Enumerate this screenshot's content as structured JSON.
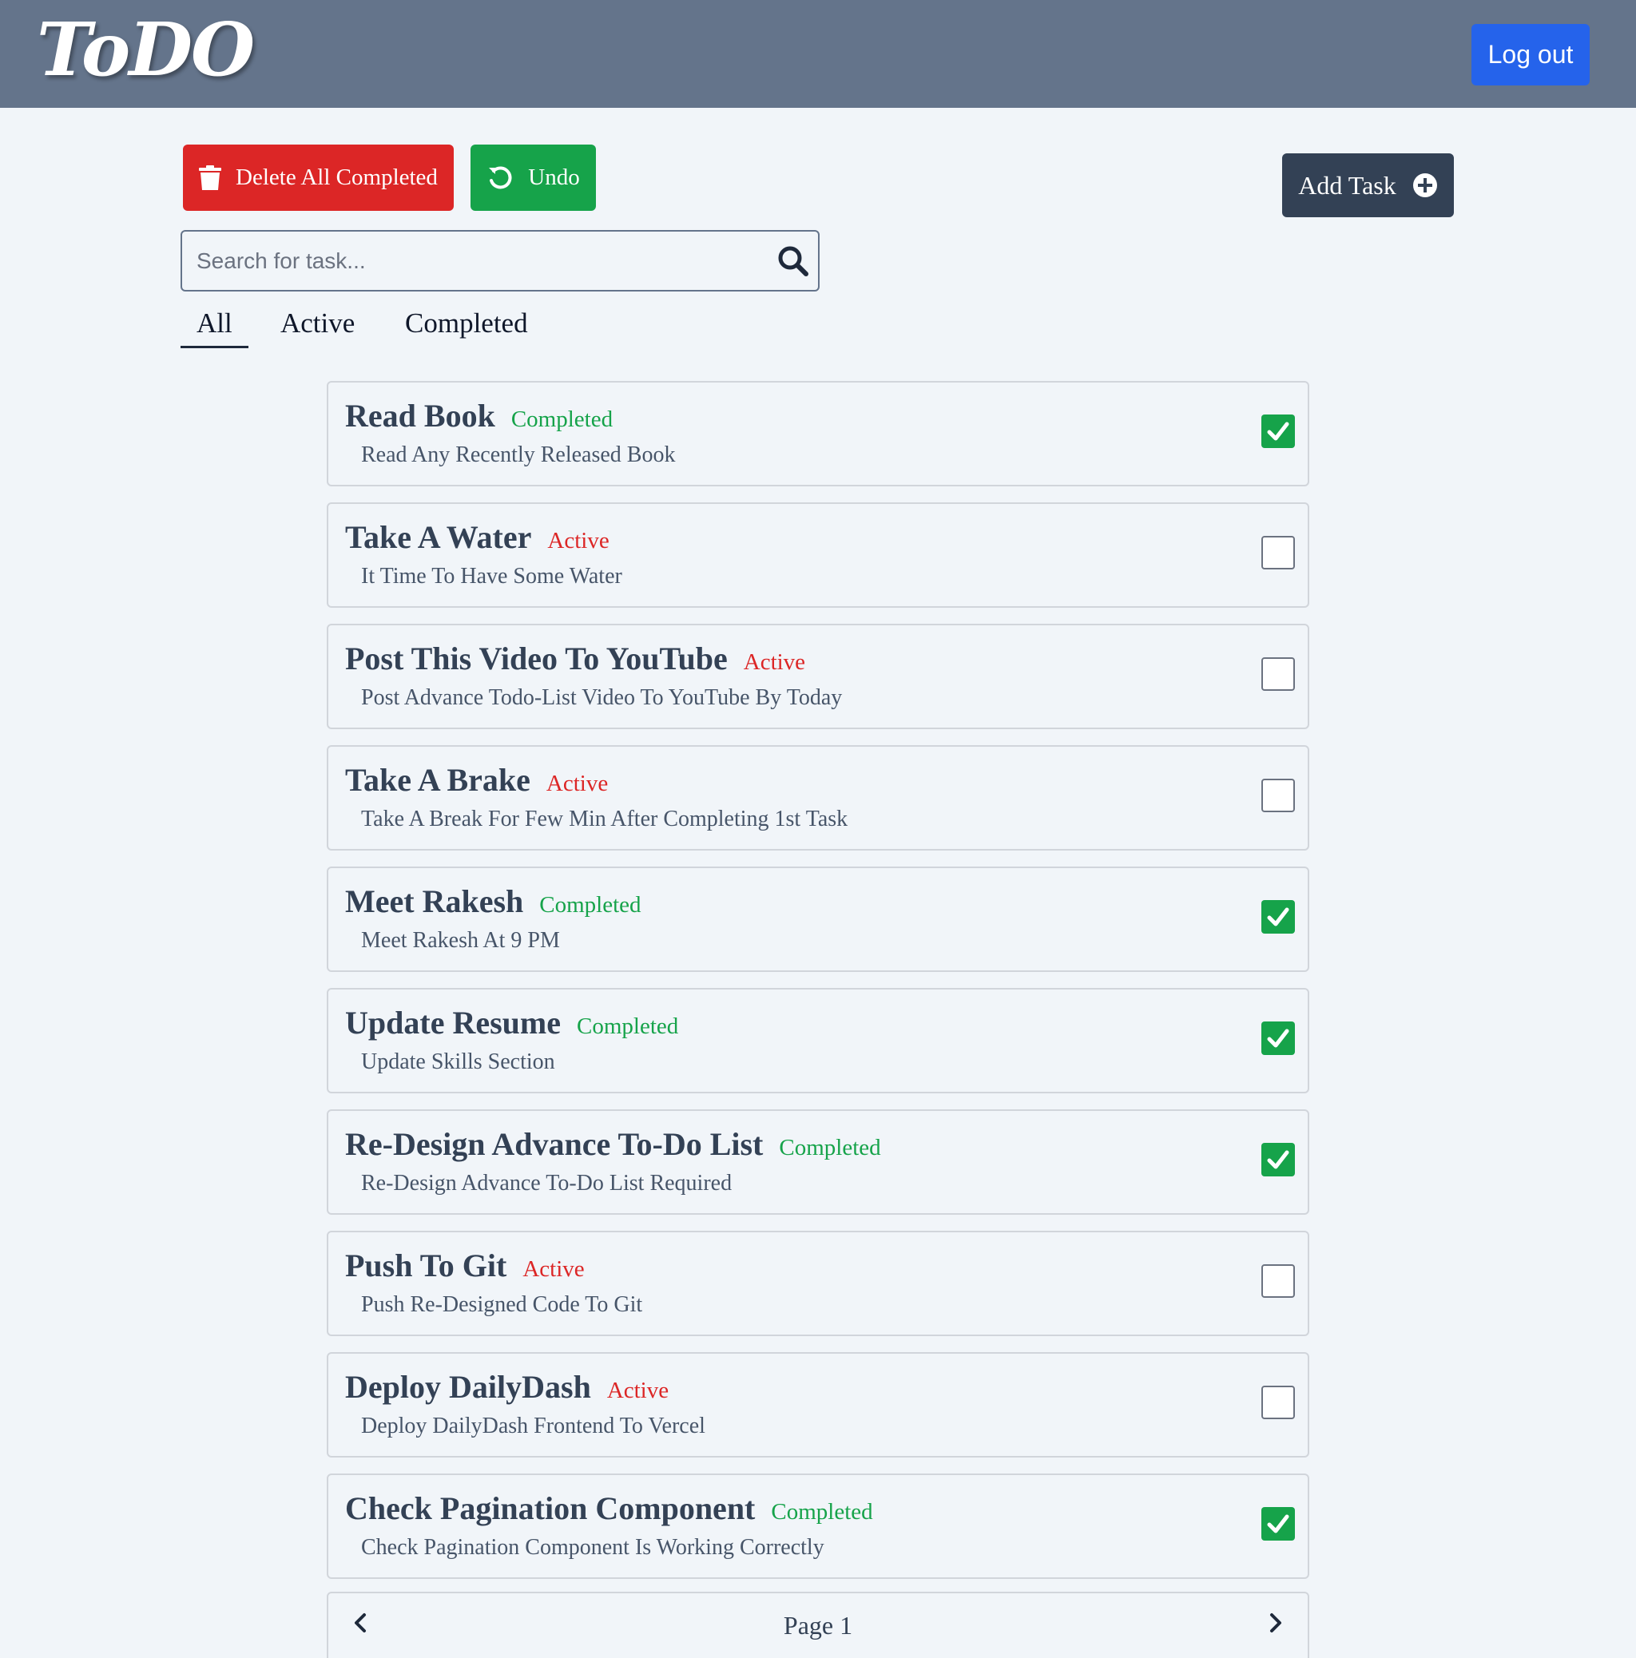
{
  "header": {
    "logo_text": "ToDO",
    "logout_label": "Log out"
  },
  "toolbar": {
    "delete_label": "Delete All Completed",
    "undo_label": "Undo",
    "add_label": "Add Task"
  },
  "search": {
    "placeholder": "Search for task...",
    "value": ""
  },
  "tabs": [
    {
      "label": "All",
      "selected": true
    },
    {
      "label": "Active",
      "selected": false
    },
    {
      "label": "Completed",
      "selected": false
    }
  ],
  "tasks": [
    {
      "title": "Read Book",
      "status": "Completed",
      "description": "Read Any Recently Released Book",
      "checked": true
    },
    {
      "title": "Take A Water",
      "status": "Active",
      "description": "It Time To Have Some Water",
      "checked": false
    },
    {
      "title": "Post This Video To YouTube",
      "status": "Active",
      "description": "Post Advance Todo-List Video To YouTube By Today",
      "checked": false
    },
    {
      "title": "Take A Brake",
      "status": "Active",
      "description": "Take A Break For Few Min After Completing 1st Task",
      "checked": false
    },
    {
      "title": "Meet Rakesh",
      "status": "Completed",
      "description": "Meet Rakesh At 9 PM",
      "checked": true
    },
    {
      "title": "Update Resume",
      "status": "Completed",
      "description": "Update Skills Section",
      "checked": true
    },
    {
      "title": "Re-Design Advance To-Do List",
      "status": "Completed",
      "description": "Re-Design Advance To-Do List Required",
      "checked": true
    },
    {
      "title": "Push To Git",
      "status": "Active",
      "description": "Push Re-Designed Code To Git",
      "checked": false
    },
    {
      "title": "Deploy DailyDash",
      "status": "Active",
      "description": "Deploy DailyDash Frontend To Vercel",
      "checked": false
    },
    {
      "title": "Check Pagination Component",
      "status": "Completed",
      "description": "Check Pagination Component Is Working Correctly",
      "checked": true
    }
  ],
  "pagination": {
    "label": "Page 1"
  },
  "colors": {
    "header_bg": "#64748b",
    "logout_bg": "#2563eb",
    "delete_bg": "#dc2626",
    "undo_bg": "#16a34a",
    "add_bg": "#334155",
    "completed": "#16a34a",
    "active": "#dc2626"
  },
  "icons": {
    "delete": "trash-icon",
    "undo": "undo-icon",
    "add": "plus-circle-icon",
    "search": "search-icon",
    "check": "check-icon",
    "prev": "chevron-left-icon",
    "next": "chevron-right-icon"
  }
}
